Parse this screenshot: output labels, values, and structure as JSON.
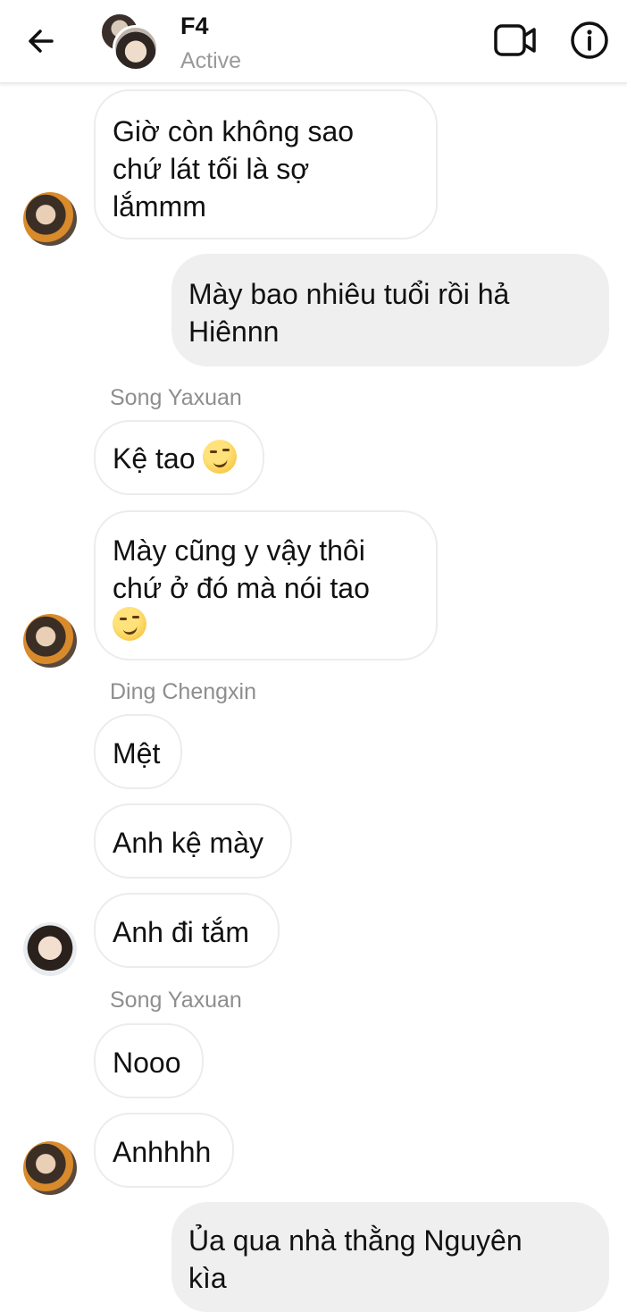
{
  "header": {
    "title": "F4",
    "status": "Active",
    "icons": {
      "back": "arrow-left-icon",
      "video": "video-camera-icon",
      "info": "info-icon"
    }
  },
  "messages": [
    {
      "text": "Giờ còn không sao\nchứ lát tối là sợ\nlắmmm"
    },
    {
      "text": "Mày bao nhiêu tuổi rồi hả\nHiênnn"
    },
    {
      "sender": "Song Yaxuan"
    },
    {
      "text": "Kệ tao",
      "emoji": "smirk-emoji"
    },
    {
      "text": "Mày cũng y vậy thôi\nchứ ở đó mà nói tao",
      "emoji": "smirk-emoji"
    },
    {
      "sender": "Ding Chengxin"
    },
    {
      "text": "Mệt"
    },
    {
      "text": "Anh kệ mày"
    },
    {
      "text": "Anh đi tắm"
    },
    {
      "sender": "Song Yaxuan"
    },
    {
      "text": "Nooo"
    },
    {
      "text": "Anhhhh"
    },
    {
      "text": "Ủa qua nhà thằng Nguyên\nkìa"
    }
  ],
  "colors": {
    "incoming_bubble": "#ffffff",
    "outgoing_bubble": "#efefef",
    "bubble_border": "#ececec",
    "muted_text": "#8e8e8e"
  }
}
